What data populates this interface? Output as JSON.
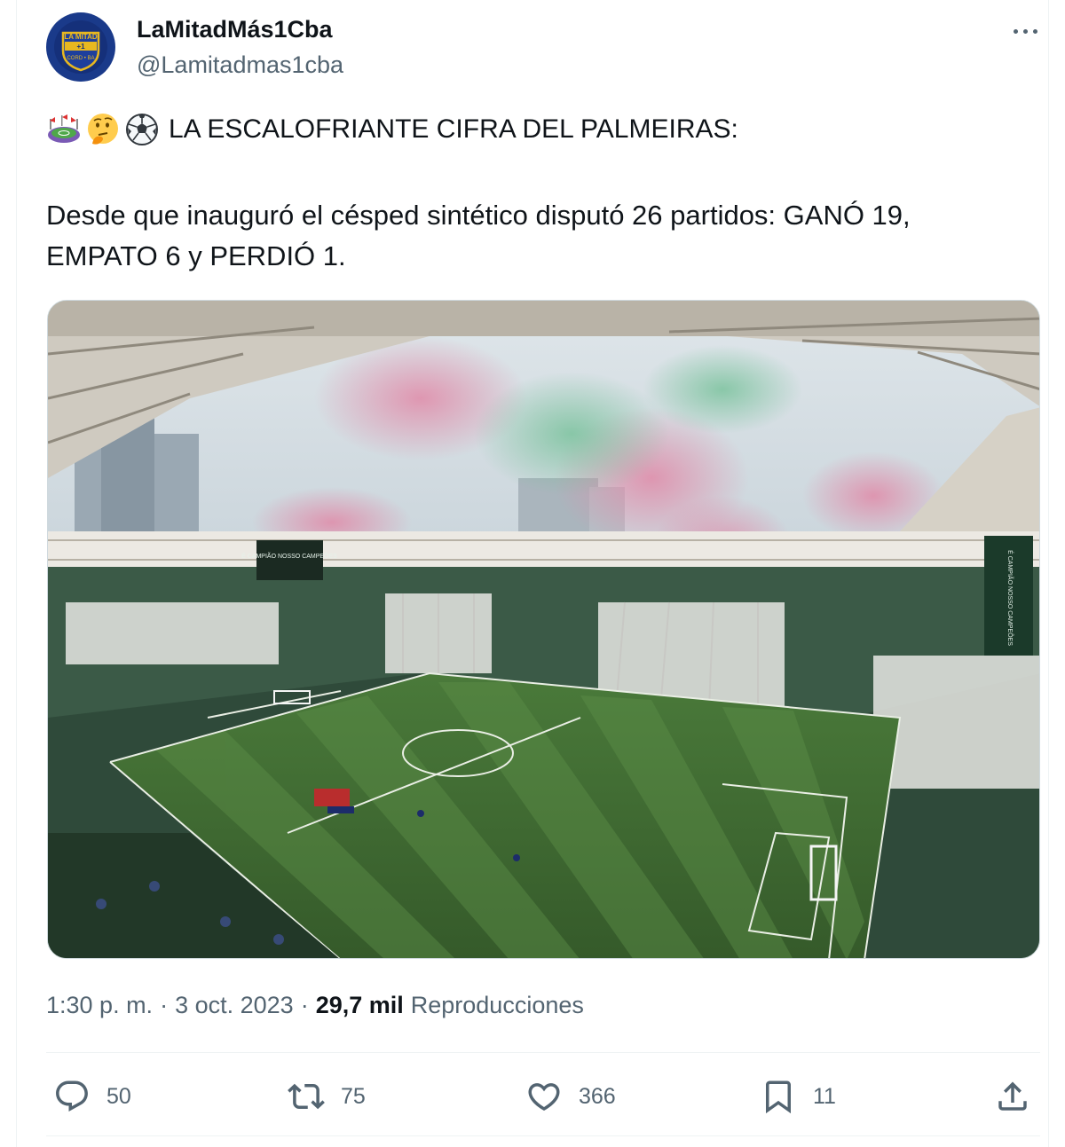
{
  "author": {
    "display_name": "LaMitadMás1Cba",
    "handle": "@Lamitadmas1cba",
    "avatar_text_top": "LA MITAD",
    "avatar_text_mid": "+1",
    "avatar_text_bottom": "CORD • BA"
  },
  "tweet": {
    "emojis": [
      "stadium-emoji",
      "thinking-face-emoji",
      "soccer-ball-emoji"
    ],
    "headline": "LA ESCALOFRIANTE CIFRA DEL PALMEIRAS:",
    "body_line_1": "Desde que inauguró el césped sintético disputó 26 partidos: GANÓ 19,",
    "body_line_2": "EMPATO 6 y PERDIÓ 1.",
    "image_banner_left": "É CAMPIÃO NOSSO CAMPEÕES",
    "image_banner_right": "É CAMPIÃO NOSSO CAMPEÕES"
  },
  "meta": {
    "time": "1:30 p. m.",
    "date": "3 oct. 2023",
    "separator": "·",
    "views": "29,7 mil",
    "views_label": "Reproducciones"
  },
  "actions": {
    "replies": "50",
    "retweets": "75",
    "likes": "366",
    "bookmarks": "11"
  },
  "colors": {
    "primary_text": "#0f1419",
    "secondary_text": "#536471",
    "divider": "#eff3f4",
    "icon": "#536471"
  }
}
